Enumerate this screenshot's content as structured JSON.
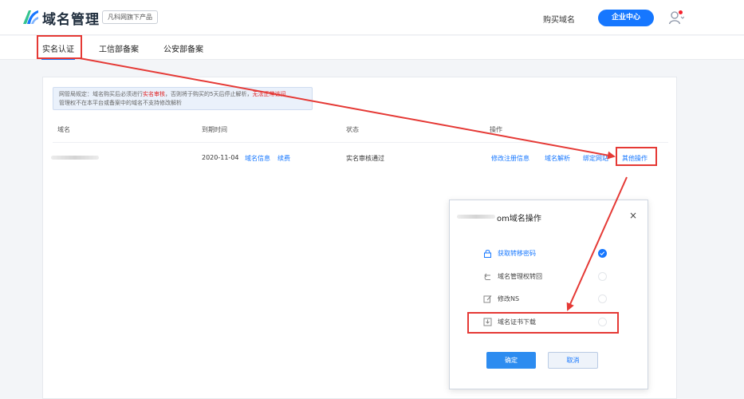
{
  "header": {
    "brand": "域名管理",
    "product_badge": "凡科网旗下产品",
    "buy_domain": "购买域名",
    "enterprise_center": "企业中心"
  },
  "tabs": [
    {
      "label": "实名认证",
      "active": true
    },
    {
      "label": "工信部备案"
    },
    {
      "label": "公安部备案"
    }
  ],
  "notice": {
    "part1": "网管局规定：域名购买后必须进行",
    "highlight1": "实名审核",
    "part2": "，否则将于购买的5天后停止解析，",
    "highlight2": "无法正常访问",
    "line2": "管理权不在本平台或备案中的域名不支持修改解析"
  },
  "table": {
    "headers": {
      "domain": "域名",
      "expiry": "到期时间",
      "status": "状态",
      "actions": "操作"
    },
    "row": {
      "expiry_date": "2020-11-04",
      "domain_info": "域名信息",
      "renew": "续费",
      "status": "实名审核通过",
      "actions": [
        "修改注册信息",
        "域名解析",
        "绑定网站",
        "其他操作"
      ]
    }
  },
  "dialog": {
    "title_suffix": "om域名操作",
    "close": "×",
    "options": [
      {
        "label": "获取转移密码",
        "icon": "lock-icon",
        "checked": true
      },
      {
        "label": "域名管理权转回",
        "icon": "return-icon",
        "checked": false
      },
      {
        "label": "修改NS",
        "icon": "edit-icon",
        "checked": false
      },
      {
        "label": "域名证书下载",
        "icon": "download-icon",
        "checked": false
      }
    ],
    "confirm": "确定",
    "cancel": "取消"
  },
  "colors": {
    "accent": "#1677ff",
    "annotation": "#e53935",
    "warning": "#e02020"
  }
}
